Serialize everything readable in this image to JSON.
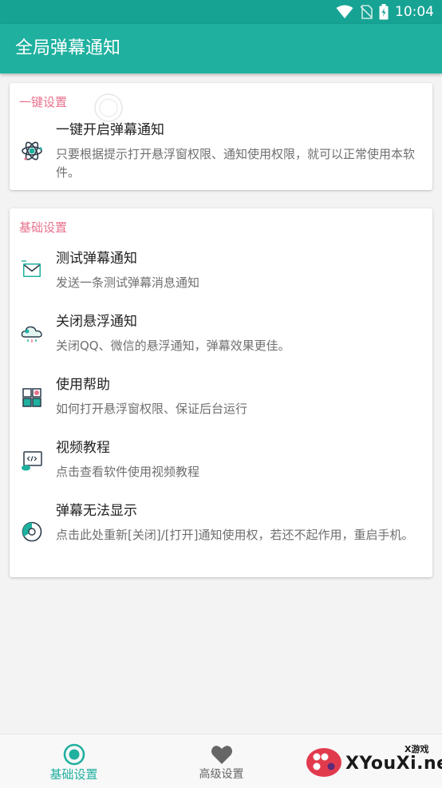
{
  "status_bar": {
    "time": "10:04"
  },
  "app_bar": {
    "title": "全局弹幕通知"
  },
  "sections": [
    {
      "title": "一键设置",
      "items": [
        {
          "title": "一键开启弹幕通知",
          "subtitle": "只要根据提示打开悬浮窗权限、通知使用权限，就可以正常使用本软件。",
          "icon": "atom-icon"
        }
      ]
    },
    {
      "title": "基础设置",
      "items": [
        {
          "title": "测试弹幕通知",
          "subtitle": "发送一条测试弹幕消息通知",
          "icon": "envelope-icon"
        },
        {
          "title": "关闭悬浮通知",
          "subtitle": "关闭QQ、微信的悬浮通知，弹幕效果更佳。",
          "icon": "cloud-icon"
        },
        {
          "title": "使用帮助",
          "subtitle": "如何打开悬浮窗权限、保证后台运行",
          "icon": "help-blocks-icon"
        },
        {
          "title": "视频教程",
          "subtitle": "点击查看软件使用视频教程",
          "icon": "video-screen-icon"
        },
        {
          "title": "弹幕无法显示",
          "subtitle": "点击此处重新[关闭]/[打开]通知使用权，若还不起作用，重启手机。",
          "icon": "pie-icon"
        }
      ]
    }
  ],
  "bottom_nav": {
    "tabs": [
      {
        "label": "基础设置",
        "icon": "radio-target-icon",
        "active": true
      },
      {
        "label": "高级设置",
        "icon": "heart-icon",
        "active": false
      }
    ]
  },
  "watermark": {
    "text": "XYouXi.net",
    "small": "X游戏"
  },
  "colors": {
    "primary": "#1fb09f",
    "status_bar": "#16a394",
    "section_title": "#e8728c"
  }
}
